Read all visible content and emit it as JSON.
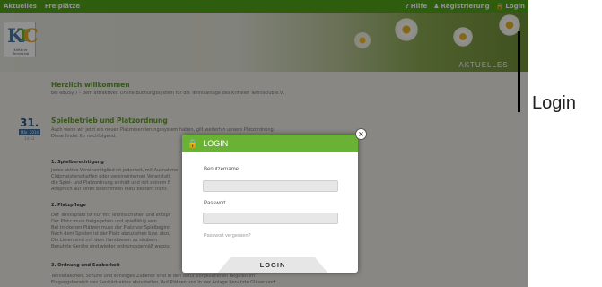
{
  "nav": {
    "left_items": [
      "Aktuelles",
      "Freiplätze"
    ],
    "help": "Hilfe",
    "register": "Registrierung",
    "login": "Login"
  },
  "logo": {
    "letters": [
      "K",
      "T",
      "C"
    ],
    "subtitle": "Kriftel er Tennisclub"
  },
  "header": {
    "section": "AKTUELLES"
  },
  "content": {
    "welcome_title": "Herzlich willkommen",
    "welcome_text": "bei eBuSy 7 - dem attraktiven Online Buchungssystem für die Tennisanlage des Krifteler Tennisclub e.V.",
    "date_day": "31.",
    "date_month": "Mär. 2014",
    "date_time": "14:53",
    "article_title": "Spielbetrieb und Platzordnung",
    "article_intro_1": "Auch wenn wir jetzt ein neues Platzreservierungssystem haben, gilt weiterhin unsere Platzordnung.",
    "article_intro_2": "Diese findet Ihr nachfolgend:",
    "section1_head": "1.   Spielberechtigung",
    "section1_lines": [
      "Jedes aktive Vereinsmitglied ist jederzeit, mit Ausnahme",
      "Clubmeisterschaften oder vereinsinternen Veranstalt",
      "die Spiel- und Platzordnung einhält und mit seinem B",
      "Anspruch auf einen bestimmten Platz besteht nicht."
    ],
    "section2_head": "2.   Platzpflege",
    "section2_lines": [
      "Der Tennisplatz ist nur mit Tennisschuhen und entspr",
      "Der Platz muss freigegeben und spielfähig sein.",
      "Bei trockenen Plätzen muss der Platz vor Spielbeginn",
      "Nach dem Spielen ist der Platz abzuziehen bzw. abzu",
      "Die Linien sind mit dem Handbesen zu säubern.",
      "Benutzte Geräte sind wieder ordnungsgemäß wegzu"
    ],
    "section3_head": "3.   Ordnung und Sauberkeit",
    "section3_lines": [
      "Tennistaschen, Schuhe und sonstiges Zubehör sind in den dafür vorgesehenen Regalen im",
      "Eingangsbereich des Sanitärtraktes abzustellen. Auf Plätzen und in der Anlage benutzte Gläser und"
    ]
  },
  "modal": {
    "title": "LOGIN",
    "username_label": "Benutzername",
    "username_value": "",
    "password_label": "Passwort",
    "password_value": "",
    "forgot": "Passwort vergessen?",
    "submit": "LOGIN",
    "close": "×"
  },
  "side_caption": "Login",
  "colors": {
    "nav_green": "#52a418",
    "modal_green": "#6ab236",
    "title_green": "#5f9a2c",
    "date_blue": "#2e5b86"
  },
  "icons": {
    "help": "question-icon",
    "register": "user-plus-icon",
    "login": "lock-icon",
    "modal_header": "lock-icon",
    "close": "close-icon"
  }
}
